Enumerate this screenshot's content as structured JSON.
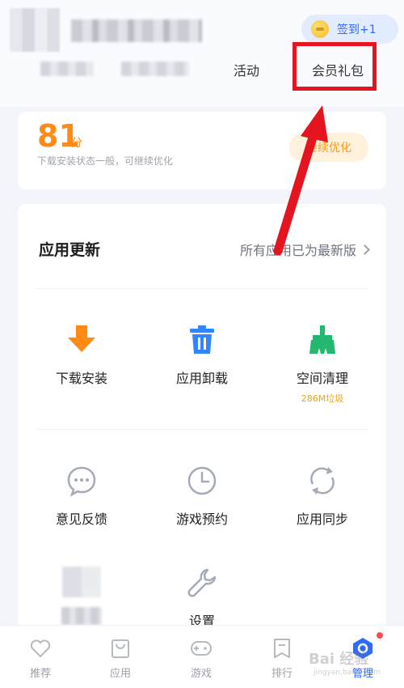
{
  "header": {
    "checkin_label": "签到+1",
    "tabs": [
      {
        "label": "活动"
      },
      {
        "label": "会员礼包"
      }
    ]
  },
  "score": {
    "value": "81",
    "unit": "分",
    "description": "下载安装状态一般，可继续优化",
    "button_label": "继续优化"
  },
  "updates": {
    "title": "应用更新",
    "status": "所有应用已为最新版"
  },
  "tools": [
    {
      "label": "下载安装",
      "icon": "download-arrow-icon"
    },
    {
      "label": "应用卸载",
      "icon": "trash-icon"
    },
    {
      "label": "空间清理",
      "sub": "286M垃圾",
      "icon": "broom-icon"
    },
    {
      "label": "意见反馈",
      "icon": "chat-bubble-icon"
    },
    {
      "label": "游戏预约",
      "icon": "clock-icon"
    },
    {
      "label": "应用同步",
      "icon": "sync-icon"
    },
    {
      "label": "设置",
      "icon": "wrench-icon"
    }
  ],
  "nav": [
    {
      "label": "推荐",
      "icon": "heart-icon"
    },
    {
      "label": "应用",
      "icon": "bag-icon"
    },
    {
      "label": "游戏",
      "icon": "gamepad-icon"
    },
    {
      "label": "排行",
      "icon": "bookmark-icon"
    },
    {
      "label": "管理",
      "icon": "hexagon-gear-icon"
    }
  ],
  "watermark": {
    "text": "Bai 经验",
    "url": "jingyan.baidu.com"
  },
  "colors": {
    "accent": "#2f6bff",
    "score": "#ff8a16",
    "highlight": "#e5141f"
  }
}
